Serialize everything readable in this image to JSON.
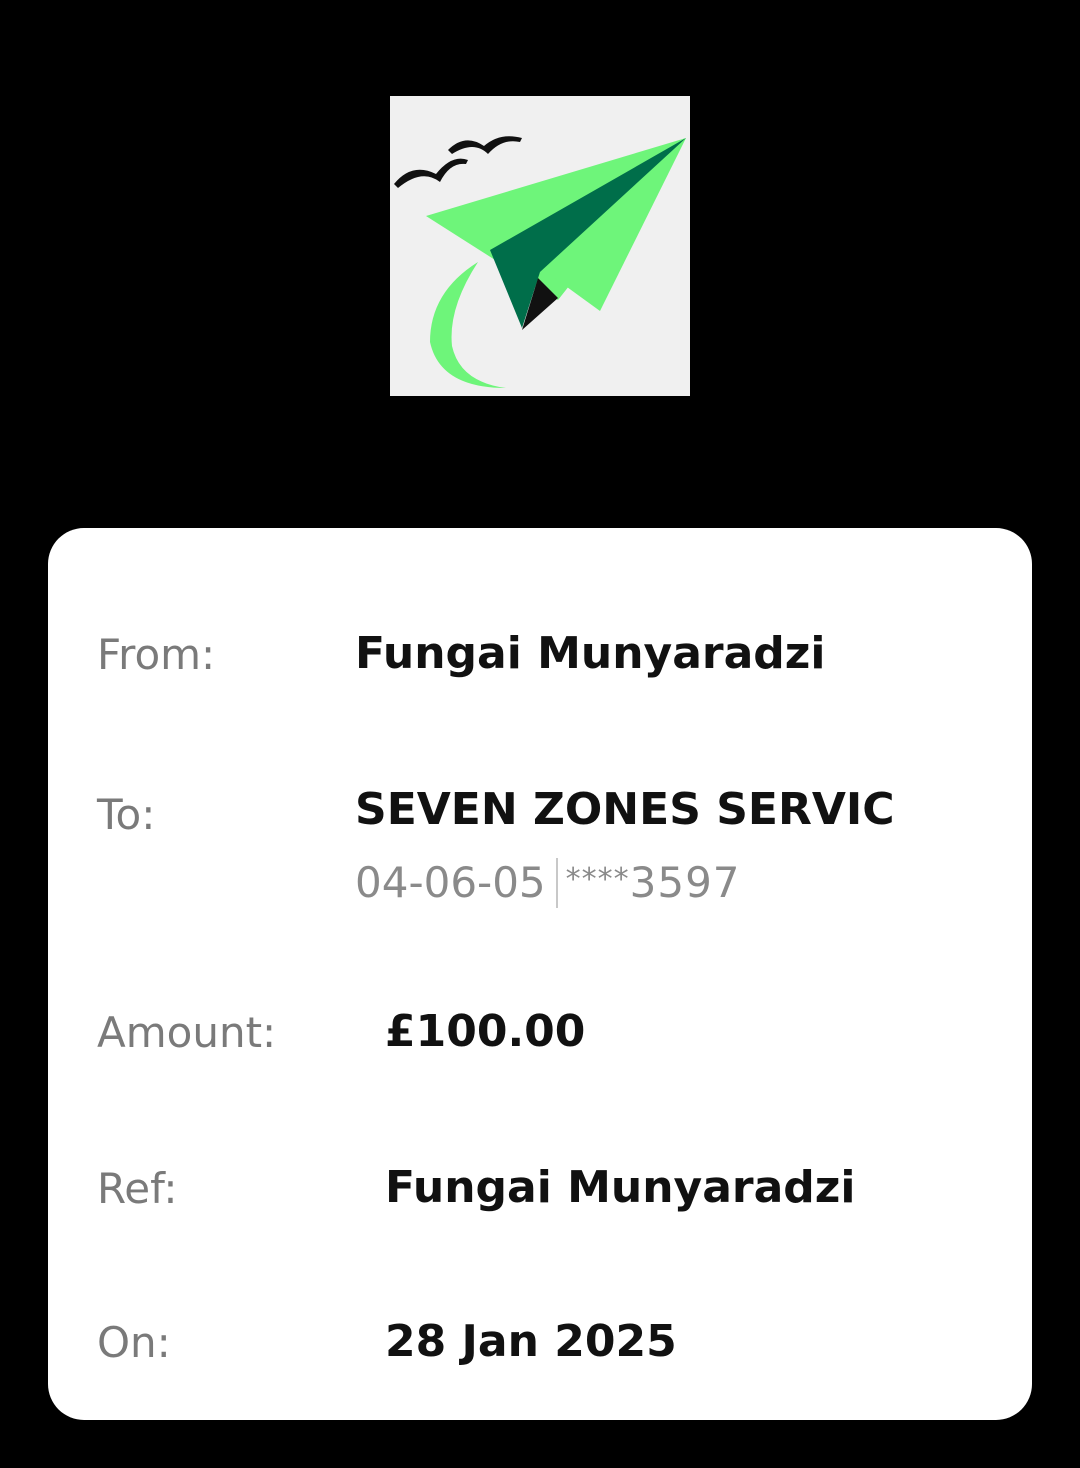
{
  "receipt": {
    "from_label": "From:",
    "from_value": "Fungai Munyaradzi",
    "to_label": "To:",
    "to_value": "SEVEN ZONES SERVIC",
    "sort_code": "04-06-05",
    "account_mask": "****",
    "account_last4": "3597",
    "amount_label": "Amount:",
    "amount_value": "£100.00",
    "ref_label": "Ref:",
    "ref_value": "Fungai Munyaradzi",
    "on_label": "On:",
    "on_value": "28 Jan 2025"
  },
  "colors": {
    "background": "#000000",
    "card": "#ffffff",
    "logo_bg": "#f0f0f0",
    "plane_light": "#6ef57a",
    "plane_dark": "#006e4a"
  },
  "icons": {
    "logo": "paper-plane-logo-icon"
  }
}
